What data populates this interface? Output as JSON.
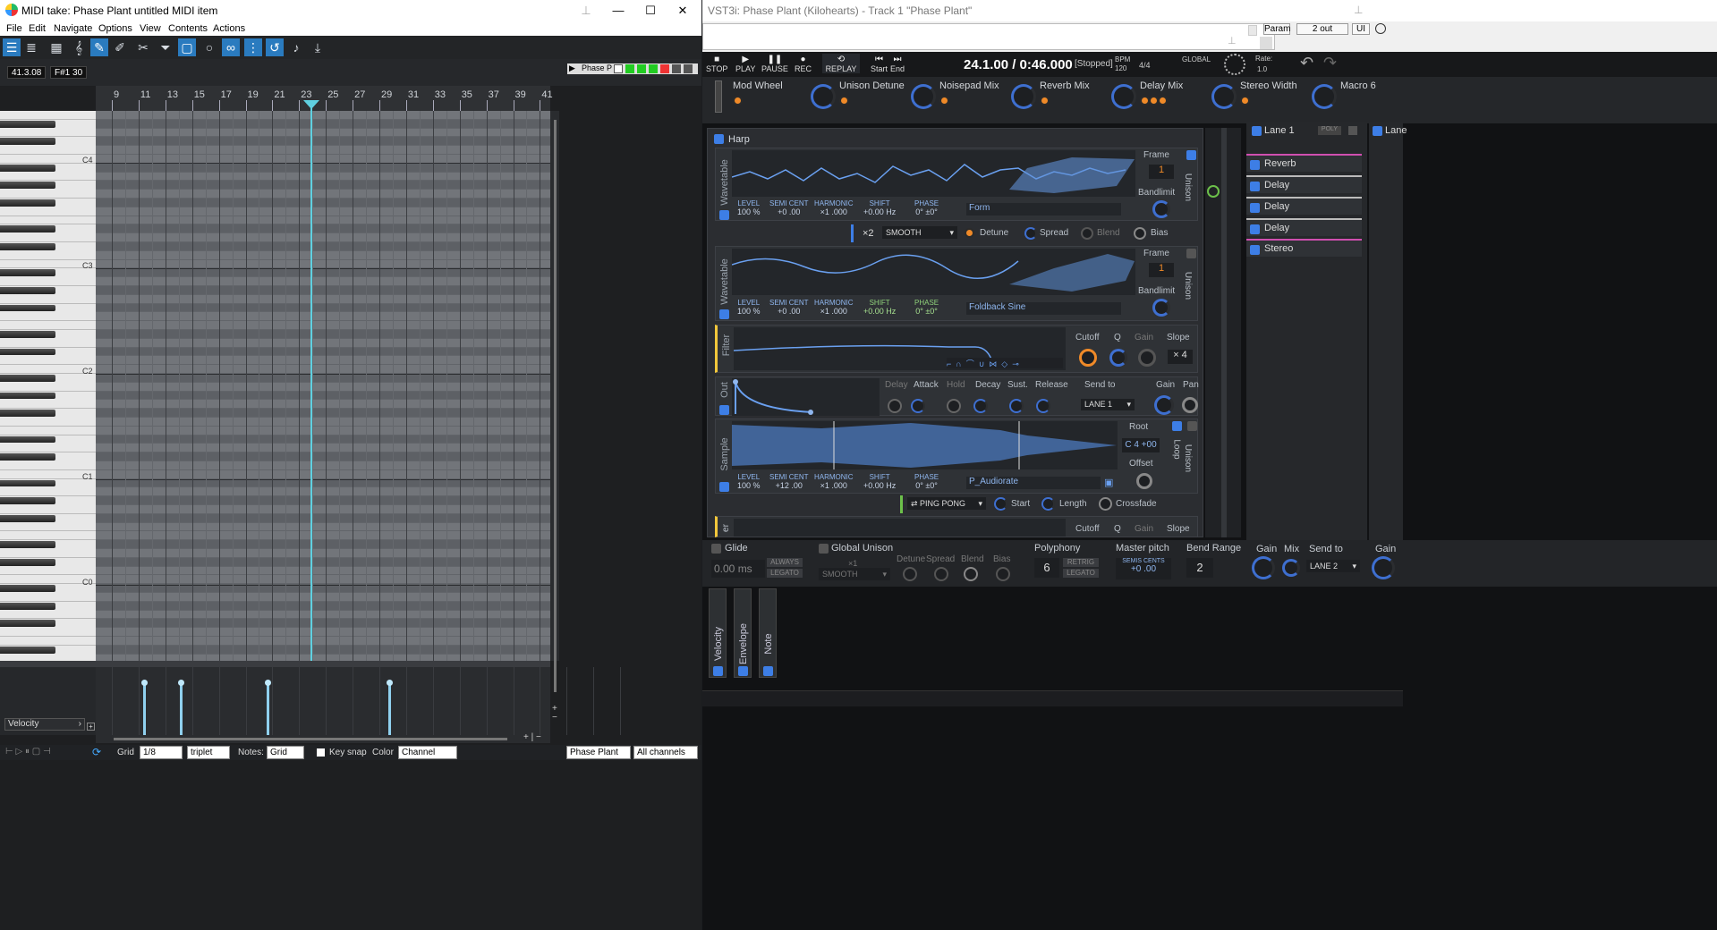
{
  "midi": {
    "title": "MIDI take: Phase Plant untitled MIDI item",
    "menu": [
      "File",
      "Edit",
      "Navigate",
      "Options",
      "View",
      "Contents",
      "Actions"
    ],
    "position": "41.3.08",
    "note": "F#1  30",
    "track_label": "Phase P",
    "ruler": [
      "9",
      "11",
      "13",
      "15",
      "17",
      "19",
      "21",
      "23",
      "25",
      "27",
      "29",
      "31",
      "33",
      "35",
      "37",
      "39",
      "41"
    ],
    "octaves": [
      "C4",
      "C3",
      "C2",
      "C1",
      "C0"
    ],
    "lane_select": "Velocity",
    "status": {
      "grid_label": "Grid",
      "grid_value": "1/8",
      "triplet": "triplet",
      "notes_label": "Notes:",
      "notes_value": "Grid",
      "keysnap": "Key snap",
      "color_label": "Color",
      "color_value": "Channel",
      "instrument": "Phase Plant",
      "channels": "All channels"
    }
  },
  "plugin": {
    "title": "VST3i: Phase Plant (Kilohearts) - Track 1 \"Phase Plant\"",
    "strip": {
      "param": "Param",
      "out": "2 out",
      "ui": "UI"
    },
    "transport": {
      "stop": "STOP",
      "play": "PLAY",
      "pause": "PAUSE",
      "rec": "REC",
      "replay": "REPLAY",
      "start": "Start",
      "end": "End",
      "time": "24.1.00 / 0:46.000",
      "state": "[Stopped]",
      "bpm_label": "BPM",
      "bpm": "120",
      "sig": "4/4",
      "global": "GLOBAL",
      "rate": "Rate:",
      "rate_val": "1.0"
    },
    "macros": [
      "Mod Wheel",
      "Unison Detune",
      "Noisepad Mix",
      "Reverb Mix",
      "Delay Mix",
      "Stereo Width",
      "Macro 6"
    ],
    "group": "Harp",
    "wt1": {
      "label": "Wavetable",
      "level": "100 %",
      "semi": "+0 .00",
      "harm": "×1 .000",
      "shift": "+0.00 Hz",
      "phase": "0° ±0°",
      "preset": "Form",
      "frame": "1"
    },
    "uni1": {
      "mult": "×2",
      "mode": "SMOOTH",
      "detune": "Detune",
      "spread": "Spread",
      "blend": "Blend",
      "bias": "Bias"
    },
    "wt2": {
      "label": "Wavetable",
      "level": "100 %",
      "semi": "+0 .00",
      "harm": "×1 .000",
      "shift": "+0.00 Hz",
      "phase": "0° ±0°",
      "preset": "Foldback Sine",
      "frame": "1"
    },
    "filter": {
      "label": "Filter",
      "cutoff": "Cutoff",
      "q": "Q",
      "gain": "Gain",
      "slope": "Slope",
      "slope_val": "× 4"
    },
    "out": {
      "label": "Out",
      "delay": "Delay",
      "attack": "Attack",
      "hold": "Hold",
      "decay": "Decay",
      "sust": "Sust.",
      "release": "Release",
      "sendto": "Send to",
      "lane": "LANE 1",
      "gain": "Gain",
      "pan": "Pan"
    },
    "sample": {
      "label": "Sample",
      "level": "100 %",
      "semi": "+12 .00",
      "harm": "×1 .000",
      "shift": "+0.00 Hz",
      "phase": "0° ±0°",
      "preset": "P_Audiorate",
      "root": "Root",
      "root_val": "C 4 +00",
      "offset": "Offset",
      "loop": "Loop",
      "mode": "PING PONG",
      "start": "Start",
      "length": "Length",
      "crossfade": "Crossfade"
    },
    "filter2": {
      "label": "er",
      "cutoff": "Cutoff",
      "q": "Q",
      "gain": "Gain",
      "slope": "Slope"
    },
    "labels": {
      "frame": "Frame",
      "bandlimit": "Bandlimit",
      "unison": "Unison",
      "level": "LEVEL",
      "semicent": "SEMI CENT",
      "harmonic": "HARMONIC",
      "shift": "SHIFT",
      "phase": "PHASE"
    },
    "lanes": {
      "lane1": "Lane 1",
      "poly": "POLY",
      "lane2": "Lane",
      "fx": [
        "Reverb",
        "Delay",
        "Delay",
        "Delay",
        "Stereo"
      ]
    },
    "bottom": {
      "glide": "Glide",
      "glide_val": "0.00 ms",
      "always": "ALWAYS",
      "legato": "LEGATO",
      "gunison": "Global Unison",
      "gu_mult": "×1",
      "gu_mode": "SMOOTH",
      "detune": "Detune",
      "spread": "Spread",
      "blend": "Blend",
      "bias": "Bias",
      "poly": "Polyphony",
      "poly_val": "6",
      "retrig": "RETRIG",
      "legato2": "LEGATO",
      "master": "Master pitch",
      "semis": "SEMIS CENTS",
      "master_val": "+0 .00",
      "bend": "Bend Range",
      "bend_val": "2",
      "gain": "Gain",
      "mix": "Mix",
      "sendto": "Send to",
      "lane2": "LANE 2",
      "gain2": "Gain"
    },
    "mods": [
      "Velocity",
      "Envelope",
      "Note"
    ]
  }
}
